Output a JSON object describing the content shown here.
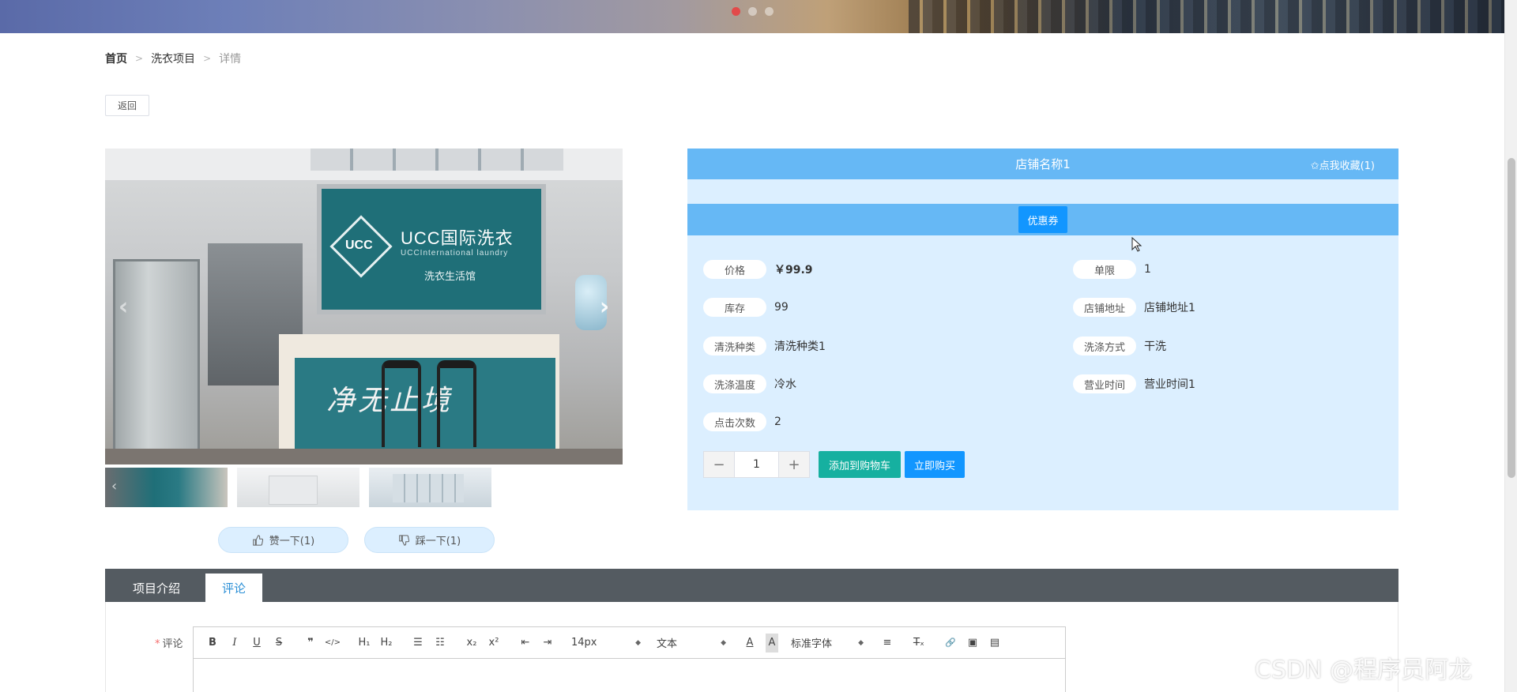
{
  "banner": {
    "carousel_dots": 3,
    "active_dot": 1
  },
  "breadcrumb": {
    "home": "首页",
    "section": "洗衣项目",
    "current": "详情",
    "separator": ">"
  },
  "back_button": "返回",
  "gallery": {
    "sign_logo": "UCC",
    "sign_brand": "UCC国际洗衣",
    "sign_brand_en": "UCCInternational laundry",
    "sign_sub": "洗衣生活馆",
    "counter_text": "净无止境",
    "prev_icon": "chevron-left-icon",
    "next_icon": "chevron-right-icon",
    "thumbnails": 3
  },
  "votes": {
    "like": "赞一下(1)",
    "dislike": "踩一下(1)"
  },
  "info": {
    "shop_name": "店铺名称1",
    "favorite": "✩点我收藏(1)",
    "coupon": "优惠券",
    "attributes": {
      "price_label": "价格",
      "price_value": "￥99.9",
      "limit_label": "单限",
      "limit_value": "1",
      "stock_label": "库存",
      "stock_value": "99",
      "address_label": "店铺地址",
      "address_value": "店铺地址1",
      "clean_type_label": "清洗种类",
      "clean_type_value": "清洗种类1",
      "wash_method_label": "洗涤方式",
      "wash_method_value": "干洗",
      "temp_label": "洗涤温度",
      "temp_value": "冷水",
      "hours_label": "营业时间",
      "hours_value": "营业时间1",
      "clicks_label": "点击次数",
      "clicks_value": "2"
    },
    "quantity": {
      "minus": "−",
      "value": "1",
      "plus": "+"
    },
    "add_to_cart": "添加到购物车",
    "buy_now": "立即购买"
  },
  "tabs": {
    "intro": "项目介绍",
    "comment": "评论"
  },
  "comment": {
    "label": "评论",
    "required_mark": "*",
    "toolbar": {
      "bold": "B",
      "italic": "I",
      "underline": "U",
      "strike": "S",
      "quote": "❞",
      "code": "</>",
      "h1": "H₁",
      "h2": "H₂",
      "ordered_list": "☰",
      "bullet_list": "☷",
      "subscript": "x₂",
      "superscript": "x²",
      "outdent": "⇤",
      "indent": "⇥",
      "size_select": "14px",
      "text_select": "文本",
      "font_color": "A",
      "bg_color": "A",
      "font_select": "标准字体",
      "align": "≡",
      "clear_format": "T̶ₓ",
      "link": "🔗",
      "image": "▣",
      "video": "▤"
    }
  },
  "watermark": "CSDN @程序员阿龙"
}
